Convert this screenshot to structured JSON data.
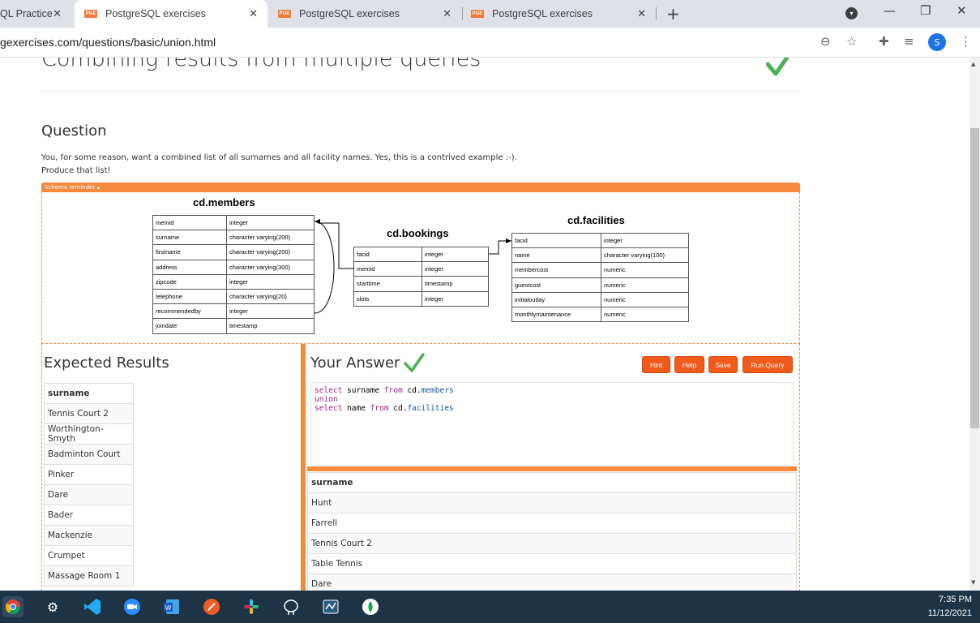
{
  "tabs": [
    {
      "title": "QL Practice",
      "has_favicon": false
    },
    {
      "title": "PostgreSQL exercises",
      "has_favicon": true,
      "active": true
    },
    {
      "title": "PostgreSQL exercises",
      "has_favicon": true
    },
    {
      "title": "PostgreSQL exercises",
      "has_favicon": true
    }
  ],
  "favicon_text": "PGE",
  "address": {
    "url": "gexercises.com/questions/basic/union.html"
  },
  "profile_initial": "S",
  "page": {
    "title": "Combining results from multiple queries",
    "question_heading": "Question",
    "question_line1": "You, for some reason, want a combined list of all surnames and all facility names. Yes, this is a contrived example :-).",
    "question_line2": "Produce that list!",
    "schema_toggle": "Schema reminder ▴"
  },
  "schema": {
    "members": {
      "title": "cd.members",
      "rows": [
        [
          "memid",
          "integer"
        ],
        [
          "surname",
          "character varying(200)"
        ],
        [
          "firstname",
          "character varying(200)"
        ],
        [
          "address",
          "character varying(300)"
        ],
        [
          "zipcode",
          "integer"
        ],
        [
          "telephone",
          "character varying(20)"
        ],
        [
          "recommendedby",
          "integer"
        ],
        [
          "joindate",
          "timestamp"
        ]
      ]
    },
    "bookings": {
      "title": "cd.bookings",
      "rows": [
        [
          "facid",
          "integer"
        ],
        [
          "memid",
          "integer"
        ],
        [
          "starttime",
          "timestamp"
        ],
        [
          "slots",
          "integer"
        ]
      ]
    },
    "facilities": {
      "title": "cd.facilities",
      "rows": [
        [
          "facid",
          "integer"
        ],
        [
          "name",
          "character varying(100)"
        ],
        [
          "membercost",
          "numeric"
        ],
        [
          "guestcost",
          "numeric"
        ],
        [
          "initialoutlay",
          "numeric"
        ],
        [
          "monthlymaintenance",
          "numeric"
        ]
      ]
    }
  },
  "expected": {
    "heading": "Expected Results",
    "column": "surname",
    "rows": [
      "Tennis Court 2",
      "Worthington-Smyth",
      "Badminton Court",
      "Pinker",
      "Dare",
      "Bader",
      "Mackenzie",
      "Crumpet",
      "Massage Room 1"
    ]
  },
  "answer": {
    "heading": "Your Answer",
    "buttons": {
      "hint": "Hint",
      "help": "Help",
      "save": "Save",
      "run": "Run Query"
    },
    "sql": [
      [
        {
          "t": "select",
          "k": "kw"
        },
        {
          "t": " surname ",
          "k": ""
        },
        {
          "t": "from",
          "k": "kw"
        },
        {
          "t": " cd.",
          "k": ""
        },
        {
          "t": "members",
          "k": "tbl"
        }
      ],
      [
        {
          "t": "union",
          "k": "kw"
        }
      ],
      [
        {
          "t": "select",
          "k": "kw"
        },
        {
          "t": " name ",
          "k": ""
        },
        {
          "t": "from",
          "k": "kw"
        },
        {
          "t": " cd.",
          "k": ""
        },
        {
          "t": "facilities",
          "k": "tbl"
        }
      ]
    ],
    "result_column": "surname",
    "result_rows": [
      "Hunt",
      "Farrell",
      "Tennis Court 2",
      "Table Tennis",
      "Dare"
    ]
  },
  "clock": {
    "time": "7:35 PM",
    "date": "11/12/2021"
  },
  "colors": {
    "accent": "#f58a3f",
    "button": "#f05a1a",
    "check": "#4caf50",
    "taskbar": "#1c3446"
  }
}
